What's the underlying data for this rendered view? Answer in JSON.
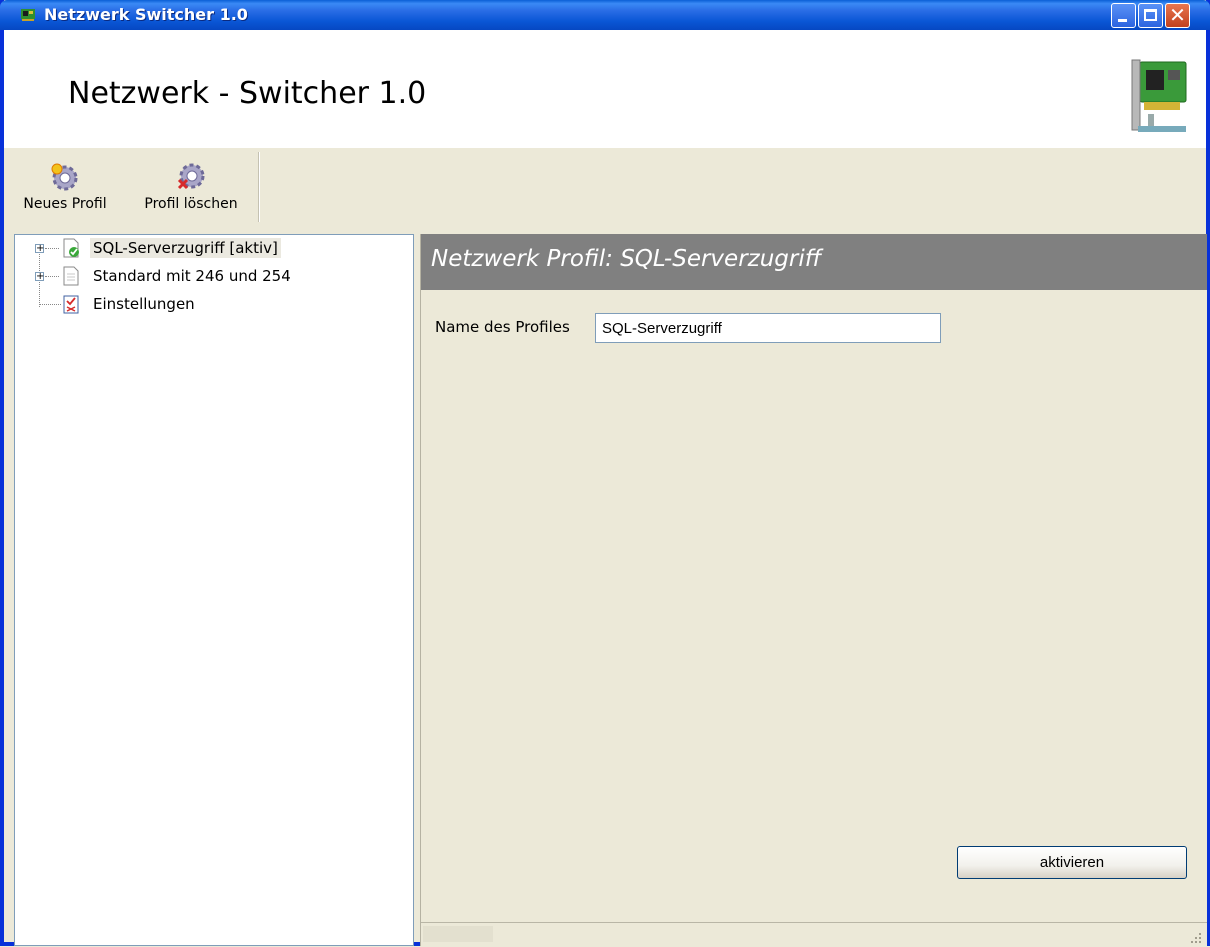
{
  "window": {
    "title": "Netzwerk Switcher 1.0"
  },
  "header": {
    "title": "Netzwerk - Switcher 1.0"
  },
  "toolbar": {
    "new_profile": "Neues Profil",
    "delete_profile": "Profil löschen"
  },
  "tree": {
    "items": [
      {
        "label": "SQL-Serverzugriff [aktiv]",
        "icon": "active-document-icon"
      },
      {
        "label": "Standard mit 246 und 254",
        "icon": "document-icon"
      },
      {
        "label": "Einstellungen",
        "icon": "settings-checklist-icon"
      }
    ]
  },
  "profile": {
    "heading": "Netzwerk Profil: SQL-Serverzugriff",
    "name_label": "Name des Profiles",
    "name_value": "SQL-Serverzugriff",
    "activate_label": "aktivieren"
  },
  "colors": {
    "titlebar": "#0a57d6",
    "header_band": "#808080",
    "face": "#ece9d8"
  }
}
